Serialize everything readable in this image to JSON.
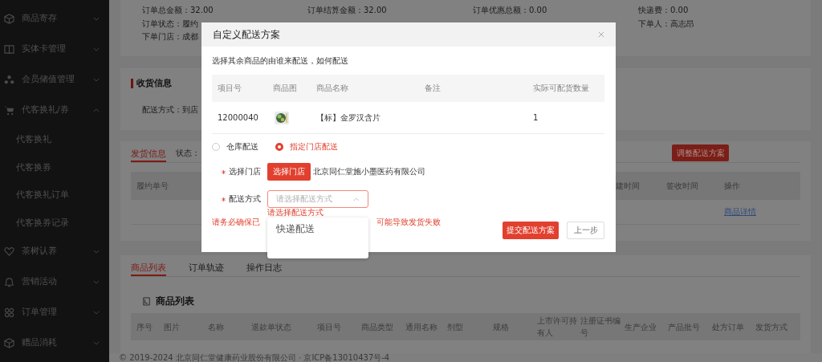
{
  "sidebar": {
    "items": [
      {
        "label": "商品寄存",
        "expanded": false
      },
      {
        "label": "实体卡管理",
        "expanded": false
      },
      {
        "label": "会员储值管理",
        "expanded": false
      },
      {
        "label": "代客换礼/券",
        "expanded": true,
        "children": [
          {
            "label": "代客换礼"
          },
          {
            "label": "代客换券"
          },
          {
            "label": "代客换礼订单"
          },
          {
            "label": "代客换券记录"
          }
        ]
      },
      {
        "label": "茶树认养",
        "expanded": false
      },
      {
        "label": "营销活动",
        "expanded": false
      },
      {
        "label": "订单管理",
        "expanded": false
      },
      {
        "label": "赠品消耗",
        "expanded": false
      }
    ]
  },
  "order_summary": {
    "rows": [
      [
        {
          "label": "订单总金额：",
          "value": "32.00"
        },
        {
          "label": "订单结算金额：",
          "value": "32.00"
        },
        {
          "label": "订单优惠总额：",
          "value": "0.00"
        },
        {
          "label": "快递费：",
          "value": "0.00"
        }
      ],
      [
        {
          "label": "订单状态：",
          "value": "履约"
        },
        null,
        null,
        {
          "label": "下单人：",
          "value": "高志昂"
        }
      ],
      [
        {
          "label": "下单门店：",
          "value": "成都"
        },
        null,
        null,
        null
      ]
    ]
  },
  "receiving": {
    "title": "收货信息",
    "field": "配送方式：到店"
  },
  "shipping": {
    "tabs": [
      {
        "label": "发货信息",
        "selected": true
      }
    ],
    "status_label": "状态：",
    "action": "调整配送方案",
    "columns": [
      "履约单号",
      "建时间",
      "签收时间",
      "操作"
    ],
    "row_link": "商品详情"
  },
  "products": {
    "tabs": [
      {
        "label": "商品列表",
        "selected": true
      },
      {
        "label": "订单轨迹",
        "selected": false
      },
      {
        "label": "操作日志",
        "selected": false
      }
    ],
    "title": "商品列表",
    "columns": [
      "序号",
      "图片",
      "名称",
      "退款单状态",
      "项目号",
      "商品类型",
      "通用名称",
      "剂型",
      "规格",
      "上市许可持有人",
      "注册证书编号",
      "生产企业",
      "产品批号",
      "处方订单",
      "发货方式"
    ]
  },
  "footer": "© 2019-2024 北京同仁堂健康药业股份有限公司 · 京ICP备13010437号-4",
  "dialog": {
    "title": "自定义配送方案",
    "intro": "选择其余商品的由谁来配送，如何配送",
    "columns": [
      "项目号",
      "商品图",
      "商品名称",
      "备注",
      "实际可配货数量"
    ],
    "rows": [
      {
        "item_no": "12000040",
        "name": "【标】金罗汉含片",
        "quantity": "1"
      }
    ],
    "delivery_options": [
      {
        "label": "仓库配送",
        "selected": false
      },
      {
        "label": "指定门店配送",
        "selected": true
      }
    ],
    "store": {
      "label": "选择门店",
      "required": true,
      "button": "选择门店",
      "value": "北京同仁堂施小墨医药有限公司"
    },
    "method": {
      "label": "配送方式",
      "required": true,
      "placeholder": "请选择配送方式",
      "expanded": true,
      "error": "请选择配送方式",
      "options": [
        {
          "label": "快递配送"
        }
      ]
    },
    "warning": [
      "请务必确保已",
      "可能导致发货失败"
    ],
    "buttons": [
      {
        "label": "提交配送方案",
        "kind": "primary"
      },
      {
        "label": "上一步",
        "kind": "default"
      }
    ]
  }
}
